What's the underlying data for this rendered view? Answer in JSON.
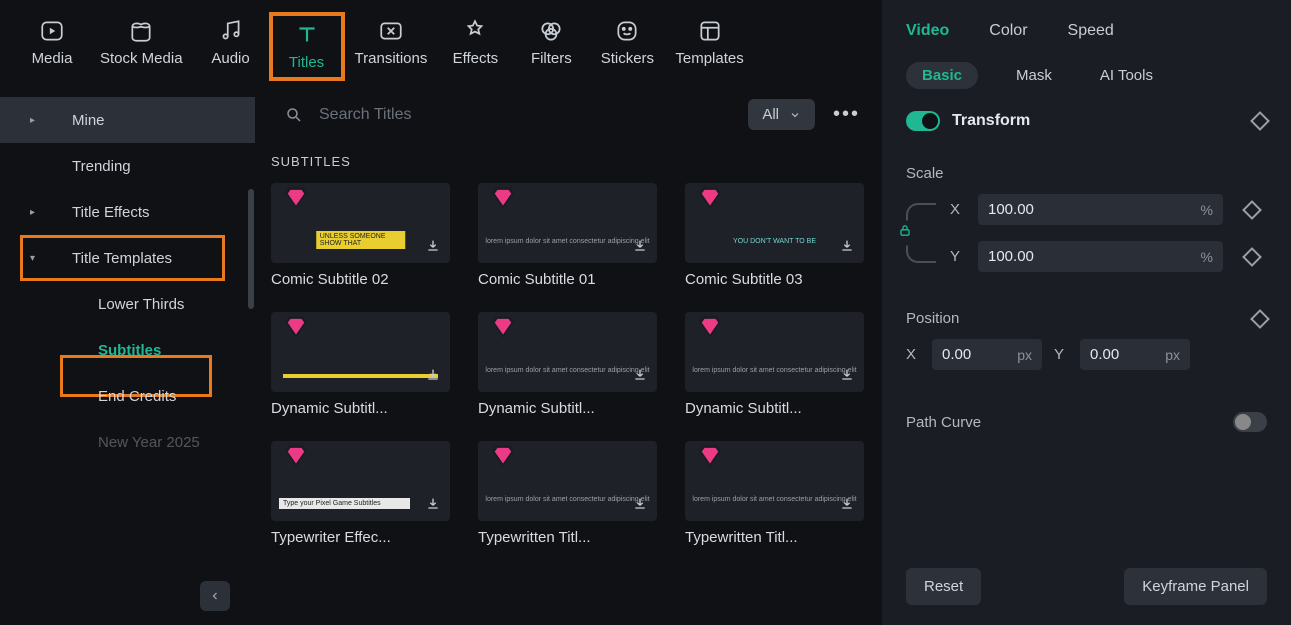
{
  "nav": [
    {
      "id": "media",
      "label": "Media"
    },
    {
      "id": "stock-media",
      "label": "Stock Media"
    },
    {
      "id": "audio",
      "label": "Audio"
    },
    {
      "id": "titles",
      "label": "Titles"
    },
    {
      "id": "transitions",
      "label": "Transitions"
    },
    {
      "id": "effects",
      "label": "Effects"
    },
    {
      "id": "filters",
      "label": "Filters"
    },
    {
      "id": "stickers",
      "label": "Stickers"
    },
    {
      "id": "templates",
      "label": "Templates"
    }
  ],
  "search": {
    "placeholder": "Search Titles"
  },
  "filter_label": "All",
  "sidebar": {
    "items": [
      {
        "label": "Mine",
        "chev": "▸"
      },
      {
        "label": "Trending"
      },
      {
        "label": "Title Effects",
        "chev": "▸"
      },
      {
        "label": "Title Templates",
        "chev": "▾"
      },
      {
        "label": "Lower Thirds",
        "sub": true
      },
      {
        "label": "Subtitles",
        "sub": true,
        "active": true
      },
      {
        "label": "End Credits",
        "sub": true
      },
      {
        "label": "New Year 2025",
        "sub": true,
        "fade": true
      }
    ]
  },
  "section_heading": "SUBTITLES",
  "cards": [
    {
      "label": "Comic Subtitle 02",
      "variant": "yellowbox"
    },
    {
      "label": "Comic Subtitle 01",
      "variant": "tinytext"
    },
    {
      "label": "Comic Subtitle 03",
      "variant": "tinytext_teal"
    },
    {
      "label": "Dynamic Subtitl...",
      "variant": "strip"
    },
    {
      "label": "Dynamic Subtitl...",
      "variant": "tinytext"
    },
    {
      "label": "Dynamic Subtitl...",
      "variant": "tinytext"
    },
    {
      "label": "Typewriter Effec...",
      "variant": "typew"
    },
    {
      "label": "Typewritten Titl...",
      "variant": "tinytext"
    },
    {
      "label": "Typewritten Titl...",
      "variant": "tinytext"
    }
  ],
  "right": {
    "tabs": [
      "Video",
      "Color",
      "Speed"
    ],
    "subtabs": [
      "Basic",
      "Mask",
      "AI Tools"
    ],
    "transform_label": "Transform",
    "scale_label": "Scale",
    "scale_x_value": "100.00",
    "scale_y_value": "100.00",
    "scale_unit": "%",
    "position_label": "Position",
    "pos_x_value": "0.00",
    "pos_y_value": "0.00",
    "pos_unit": "px",
    "path_curve_label": "Path Curve",
    "reset_label": "Reset",
    "keyframe_label": "Keyframe Panel",
    "axis_x": "X",
    "axis_y": "Y"
  }
}
